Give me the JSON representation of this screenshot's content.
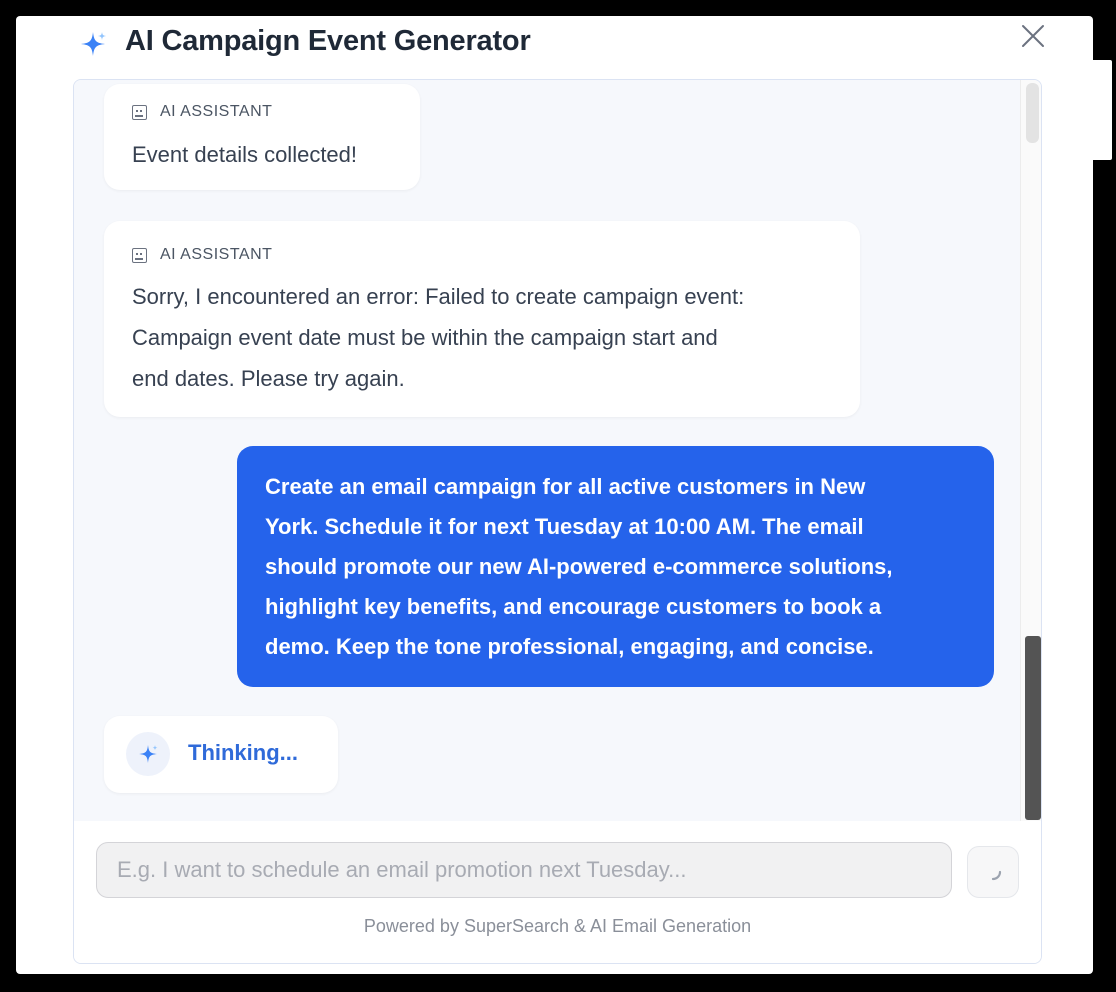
{
  "header": {
    "title": "AI Campaign Event Generator",
    "icon": "sparkle-icon",
    "close_icon": "close-icon"
  },
  "messages": [
    {
      "role": "assistant",
      "label": "AI ASSISTANT",
      "lines": [
        "Event details collected!"
      ]
    },
    {
      "role": "assistant",
      "label": "AI ASSISTANT",
      "lines": [
        "Sorry, I encountered an error: Failed to create campaign event:",
        "Campaign event date must be within the campaign start and",
        "end dates. Please try again."
      ]
    },
    {
      "role": "user",
      "lines": [
        "Create an email campaign for all active customers in New",
        "York. Schedule it for next Tuesday at 10:00 AM. The email",
        "should promote our new AI-powered e-commerce solutions,",
        "highlight key benefits, and encourage customers to book a",
        "demo. Keep the tone professional, engaging, and concise."
      ]
    }
  ],
  "thinking": {
    "label": "Thinking..."
  },
  "composer": {
    "placeholder": "E.g. I want to schedule an email promotion next Tuesday...",
    "value": "",
    "send_icon": "loading-spinner-icon"
  },
  "footer": {
    "text": "Powered by SuperSearch & AI Email Generation"
  },
  "colors": {
    "accent": "#2563eb",
    "thinking_text": "#2f6ad9",
    "background": "#f6f8fc"
  }
}
